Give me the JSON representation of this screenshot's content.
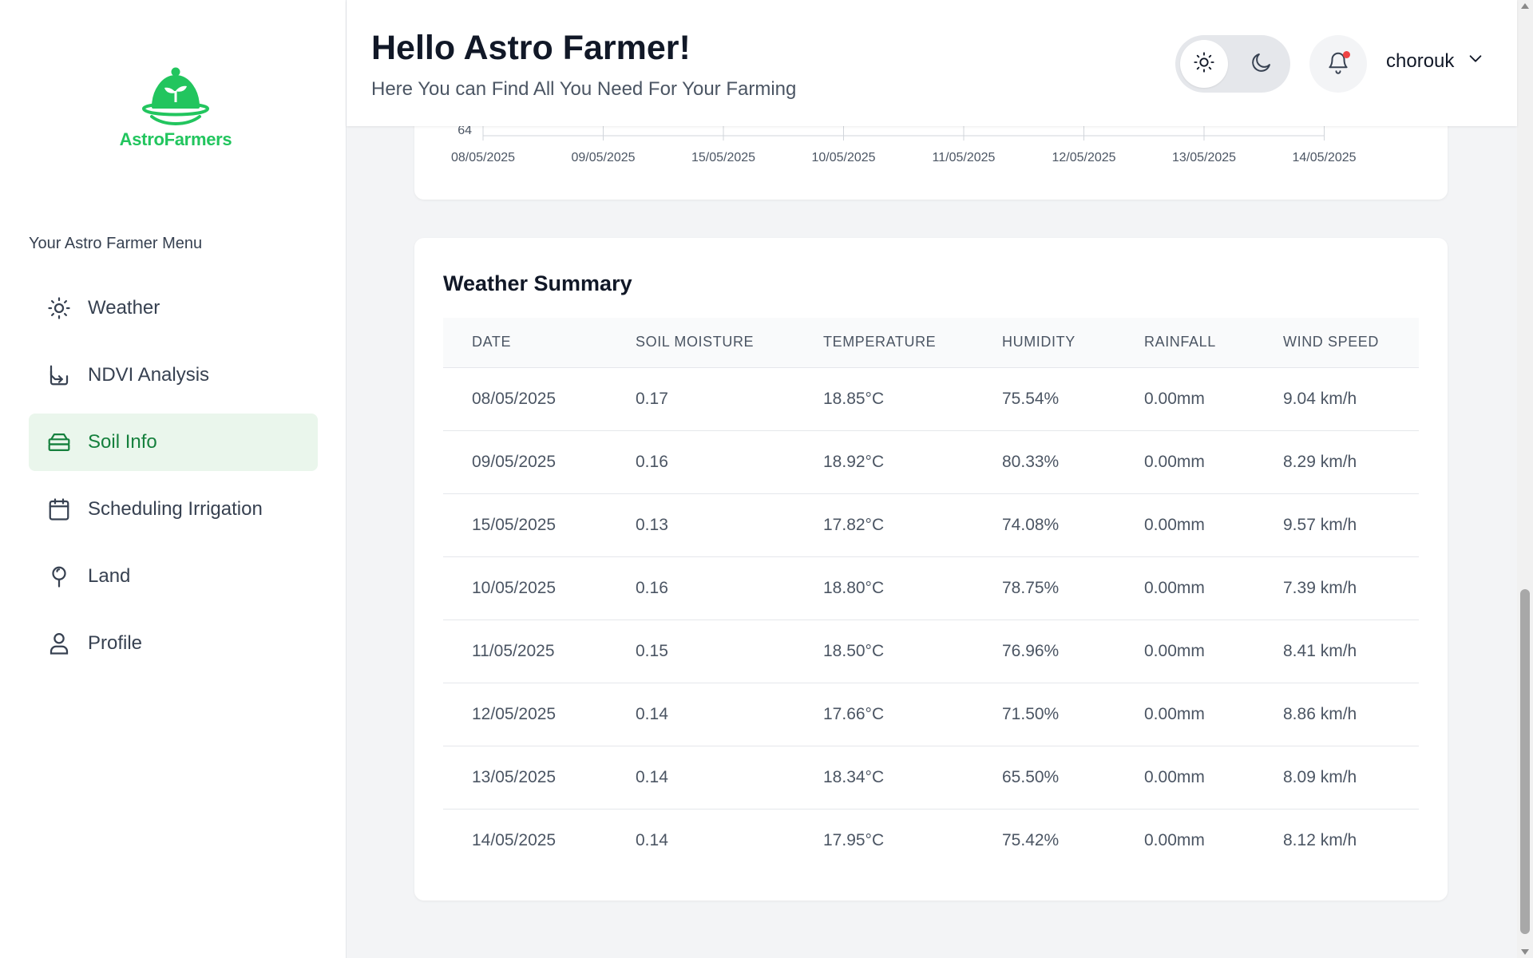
{
  "brand": {
    "name": "AstroFarmers",
    "color": "#22c55e"
  },
  "sidebar": {
    "title": "Your Astro Farmer Menu",
    "items": [
      {
        "label": "Weather",
        "icon": "sun-icon"
      },
      {
        "label": "NDVI Analysis",
        "icon": "download-icon"
      },
      {
        "label": "Soil Info",
        "icon": "layers-icon",
        "active": true
      },
      {
        "label": "Scheduling Irrigation",
        "icon": "calendar-icon"
      },
      {
        "label": "Land",
        "icon": "map-pin-icon"
      },
      {
        "label": "Profile",
        "icon": "user-icon"
      }
    ]
  },
  "header": {
    "greeting": "Hello Astro Farmer!",
    "subtitle": "Here You can Find All You Need For Your Farming",
    "username": "chorouk"
  },
  "chart_data": {
    "type": "line",
    "visible_y_tick": "64",
    "categories": [
      "08/05/2025",
      "09/05/2025",
      "15/05/2025",
      "10/05/2025",
      "11/05/2025",
      "12/05/2025",
      "13/05/2025",
      "14/05/2025"
    ]
  },
  "summary": {
    "title": "Weather Summary",
    "columns": [
      "DATE",
      "SOIL MOISTURE",
      "TEMPERATURE",
      "HUMIDITY",
      "RAINFALL",
      "WIND SPEED"
    ],
    "rows": [
      [
        "08/05/2025",
        "0.17",
        "18.85°C",
        "75.54%",
        "0.00mm",
        "9.04 km/h"
      ],
      [
        "09/05/2025",
        "0.16",
        "18.92°C",
        "80.33%",
        "0.00mm",
        "8.29 km/h"
      ],
      [
        "15/05/2025",
        "0.13",
        "17.82°C",
        "74.08%",
        "0.00mm",
        "9.57 km/h"
      ],
      [
        "10/05/2025",
        "0.16",
        "18.80°C",
        "78.75%",
        "0.00mm",
        "7.39 km/h"
      ],
      [
        "11/05/2025",
        "0.15",
        "18.50°C",
        "76.96%",
        "0.00mm",
        "8.41 km/h"
      ],
      [
        "12/05/2025",
        "0.14",
        "17.66°C",
        "71.50%",
        "0.00mm",
        "8.86 km/h"
      ],
      [
        "13/05/2025",
        "0.14",
        "18.34°C",
        "65.50%",
        "0.00mm",
        "8.09 km/h"
      ],
      [
        "14/05/2025",
        "0.14",
        "17.95°C",
        "75.42%",
        "0.00mm",
        "8.12 km/h"
      ]
    ]
  }
}
